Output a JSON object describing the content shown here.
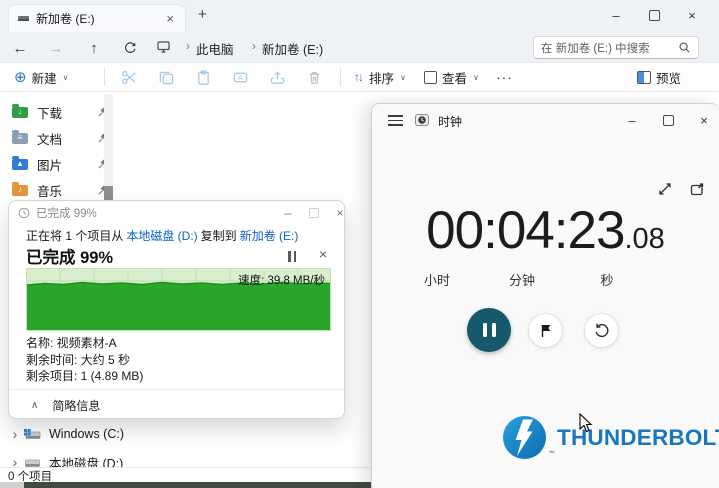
{
  "glyphs": {
    "close": "×",
    "minimize": "–",
    "new_tab": "+",
    "back": "←",
    "forward": "→",
    "up": "↑",
    "crumb_sep": "›",
    "chevron_down": "∨",
    "sort_arrows": "↑↓",
    "more": "···",
    "collapse": "∧",
    "drive_expand": "›"
  },
  "explorer": {
    "tab": {
      "title": "新加卷 (E:)"
    },
    "breadcrumb": {
      "root": "此电脑",
      "current": "新加卷 (E:)"
    },
    "search": {
      "text": "在 新加卷 (E:) 中搜索"
    },
    "toolbar": {
      "new": "新建",
      "sort": "排序",
      "view": "查看",
      "preview": "预览"
    },
    "quick_access": [
      {
        "label": "下载"
      },
      {
        "label": "文档"
      },
      {
        "label": "图片"
      },
      {
        "label": "音乐"
      }
    ],
    "drives": [
      {
        "label": "Windows (C:)"
      },
      {
        "label": "本地磁盘 (D:)"
      }
    ],
    "status": {
      "items": "0 个项目"
    }
  },
  "copy_dialog": {
    "title": "已完成 99%",
    "desc": {
      "prefix": "正在将 1 个项目从",
      "source": "本地磁盘 (D:)",
      "mid": "复制到",
      "dest": "新加卷 (E:)"
    },
    "heading": "已完成 99%",
    "progress_percent": 99,
    "speed_label": "速度: 39.8 MB/秒",
    "speed_mb_per_s": 39.8,
    "details": {
      "name": "名称: 视频素材-A",
      "time_left": "剩余时间: 大约 5 秒",
      "items_left": "剩余项目: 1 (4.89 MB)"
    },
    "toggle": "简略信息"
  },
  "clock": {
    "title": "时钟",
    "time": "00:04:23",
    "fraction": ".08",
    "labels": {
      "hours": "小时",
      "minutes": "分钟",
      "seconds": "秒"
    }
  },
  "thunderbolt": {
    "brand": "THUNDERBOLT.",
    "tm": "™"
  },
  "colors": {
    "link_blue": "#0B62C9",
    "chart_light_green": "#D8EECC",
    "chart_dark_green": "#2AA62A",
    "pause_teal": "#16596C",
    "thunderbolt_blue": "#1B76BC"
  }
}
